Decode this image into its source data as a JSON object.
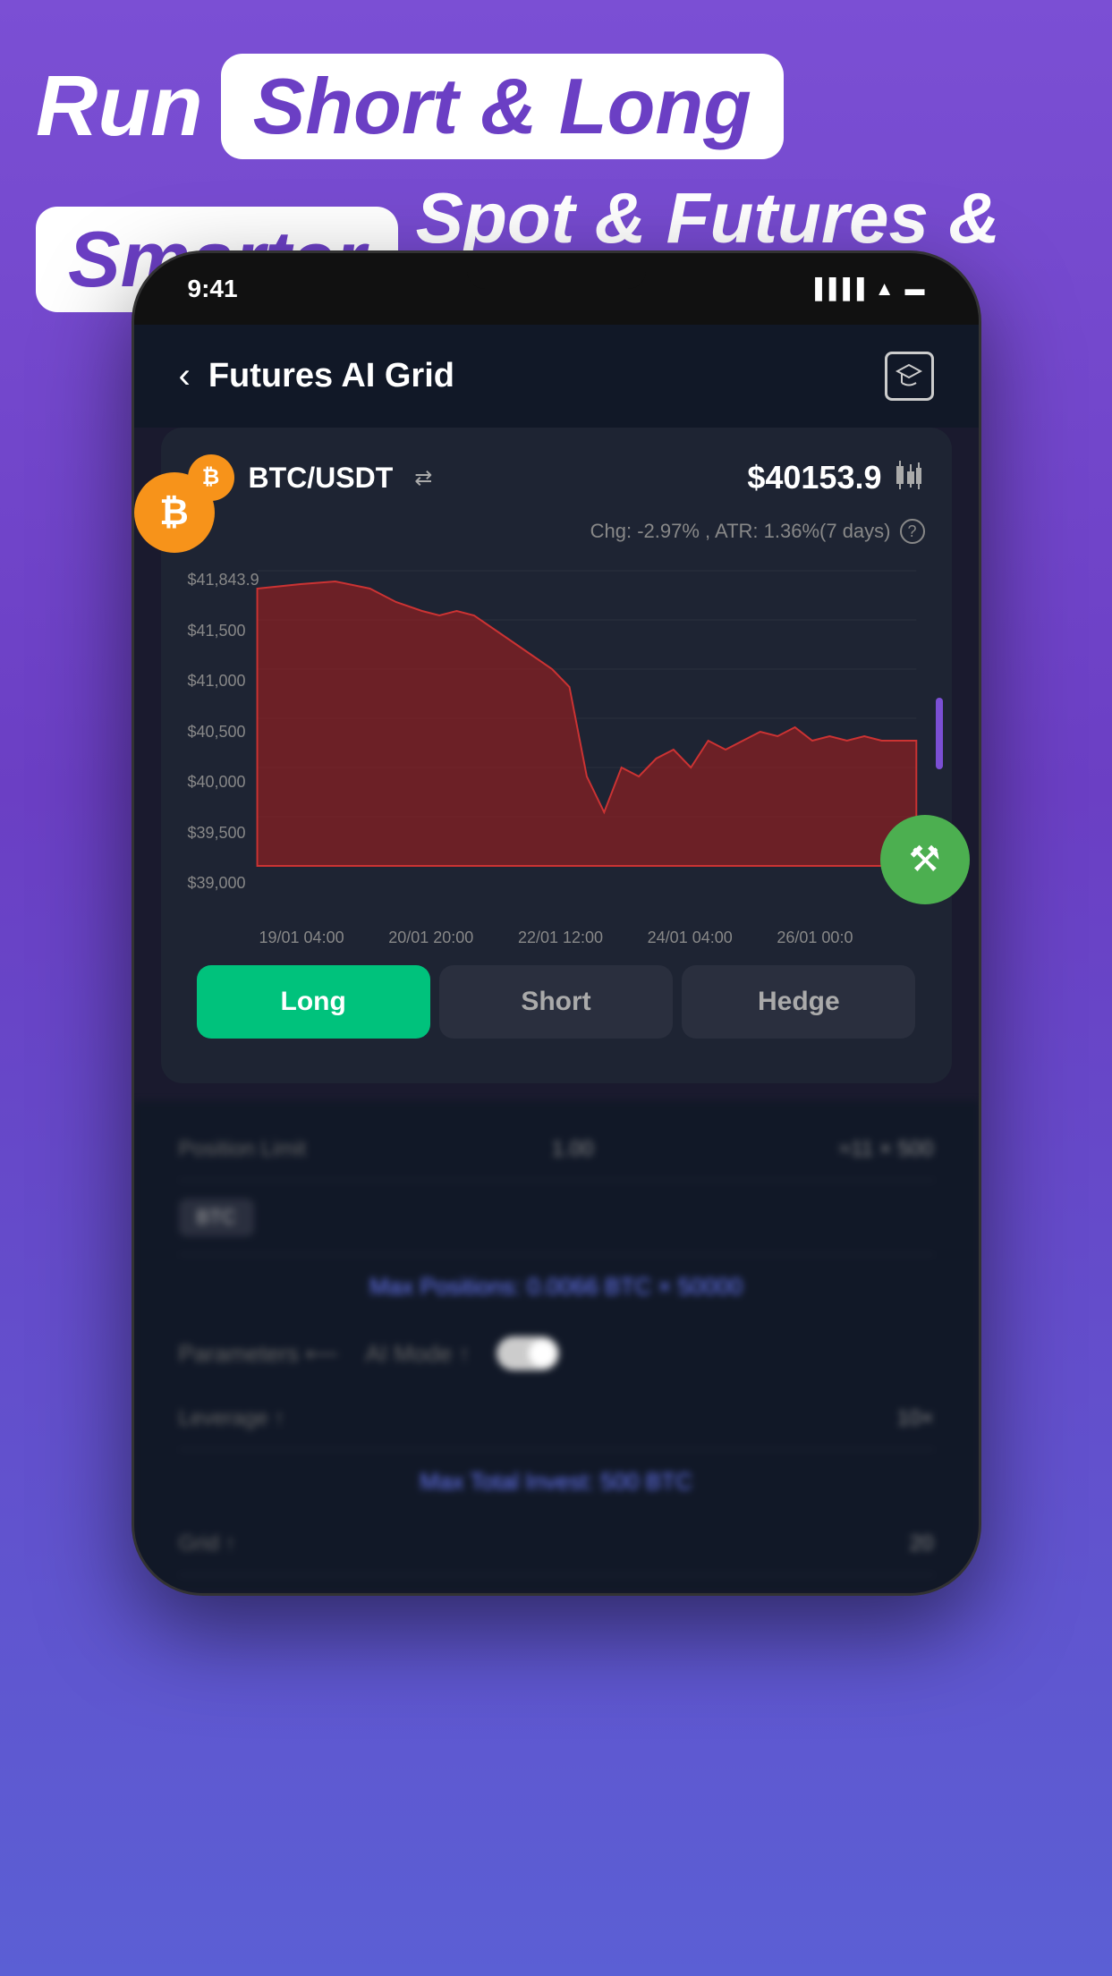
{
  "header": {
    "line1_run": "Run",
    "line1_highlight": "Short & Long",
    "line2_smarter": "Smarter",
    "line2_rest": "Spot & Futures & Arbitrage"
  },
  "phone": {
    "time": "9:41",
    "appTitle": "Futures AI Grid",
    "backLabel": "‹",
    "capIconLabel": "🎓"
  },
  "trading": {
    "pair": "BTC/USDT",
    "price": "$40153.9",
    "chartInfo": "Chg: -2.97% , ATR: 1.36%(7 days)",
    "yLabels": [
      "$41,843.9",
      "$41,500",
      "$41,000",
      "$40,500",
      "$40,000",
      "$39,500",
      "$39,000"
    ],
    "xLabels": [
      "19/01 04:00",
      "20/01 20:00",
      "22/01 12:00",
      "24/01 04:00",
      "26/01 00:0"
    ],
    "tabs": {
      "long": "Long",
      "short": "Short",
      "hedge": "Hedge"
    }
  },
  "blurred": {
    "row1_label": "Position Limit",
    "row1_value": "1.00",
    "row1_extra": "≈11 × 500",
    "tag": "BTC",
    "blue_text": "Max Positions: 0.0066 BTC × 50000",
    "params_label": "Parameters ⟵",
    "ai_mode": "AI Mode ↑",
    "leverage_label": "Leverage ↑",
    "leverage_value": "10×",
    "blue_text2": "Max Total Invest: 500 BTC"
  },
  "colors": {
    "background": "#7B4FD4",
    "appBg": "#111827",
    "cardBg": "#1e2433",
    "tabLong": "#00C27C",
    "tabInactive": "#2a2f3e",
    "chartRed": "#8B2020",
    "chartRedFill": "rgba(180, 40, 40, 0.6)"
  }
}
